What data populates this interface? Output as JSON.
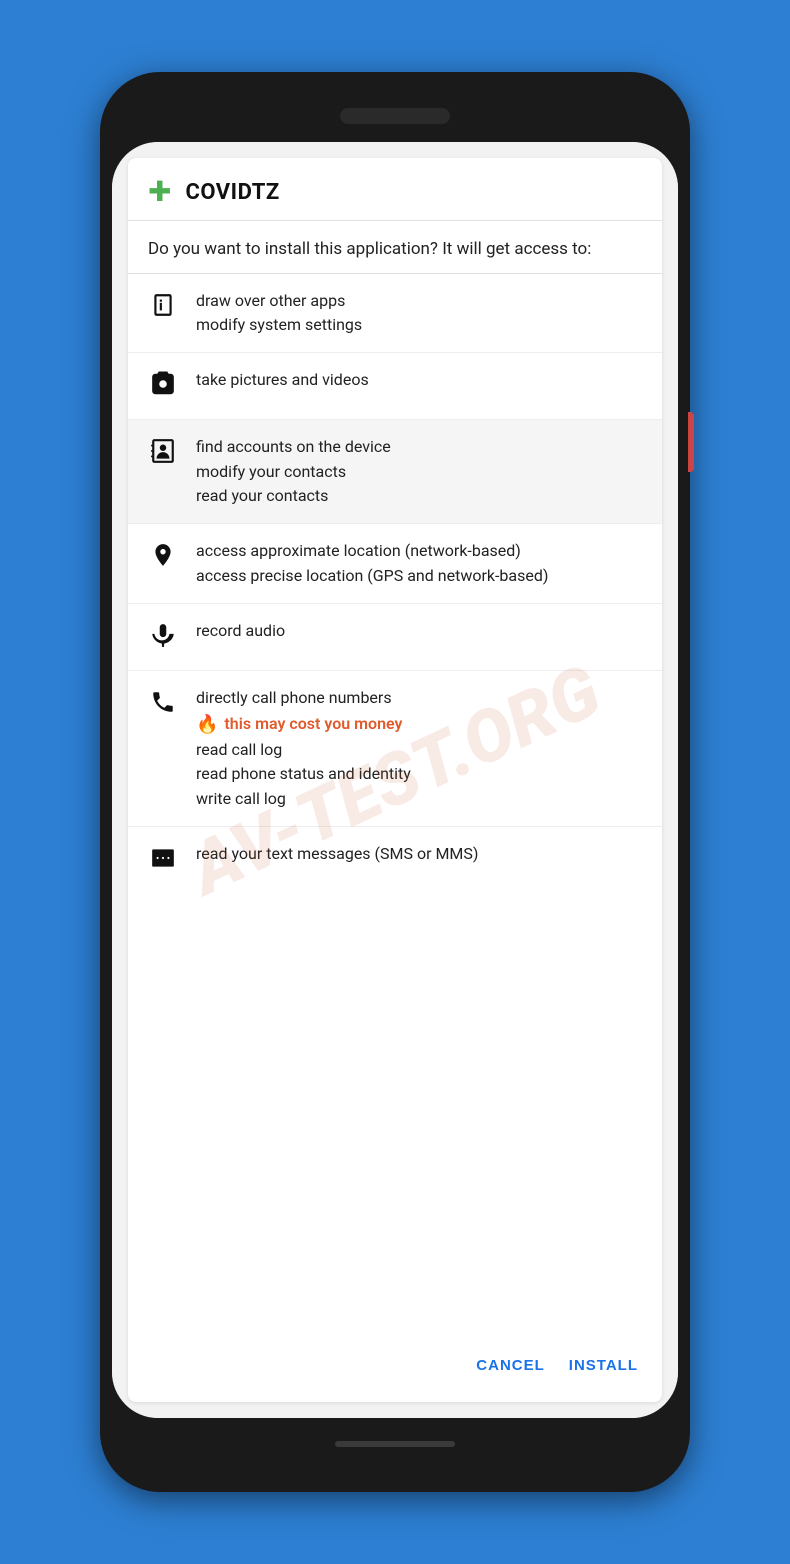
{
  "phone": {
    "app_name": "COVIDTZ",
    "install_question": "Do you want to install this application? It will get access to:",
    "watermark": "AV-TEST.ORG",
    "permissions": [
      {
        "icon_name": "info-icon",
        "texts": [
          "draw over other apps",
          "modify system settings"
        ]
      },
      {
        "icon_name": "camera-icon",
        "texts": [
          "take pictures and videos"
        ]
      },
      {
        "icon_name": "contacts-icon",
        "texts": [
          "find accounts on the device",
          "modify your contacts",
          "read your contacts"
        ]
      },
      {
        "icon_name": "location-icon",
        "texts": [
          "access approximate location (network-based)",
          "access precise location (GPS and network-based)"
        ]
      },
      {
        "icon_name": "microphone-icon",
        "texts": [
          "record audio"
        ]
      },
      {
        "icon_name": "phone-icon",
        "texts": [
          "directly call phone numbers"
        ],
        "warning": "this may cost you money",
        "extra_texts": [
          "read call log",
          "read phone status and identity",
          "write call log"
        ]
      },
      {
        "icon_name": "sms-icon",
        "texts": [
          "read your text messages (SMS or MMS)"
        ]
      }
    ],
    "buttons": {
      "cancel": "CANCEL",
      "install": "INSTALL"
    }
  }
}
